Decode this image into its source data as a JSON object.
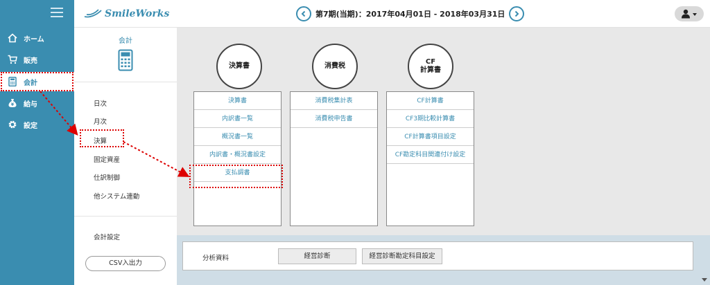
{
  "header": {
    "logo_text": "SmileWorks",
    "period": "第7期(当期)：2017年04月01日 - 2018年03月31日"
  },
  "nav": {
    "items": [
      {
        "label": "ホーム",
        "icon": "home-icon"
      },
      {
        "label": "販売",
        "icon": "cart-icon"
      },
      {
        "label": "会計",
        "icon": "calculator-icon",
        "active": true
      },
      {
        "label": "給与",
        "icon": "money-bag-icon"
      },
      {
        "label": "設定",
        "icon": "gear-icon"
      }
    ]
  },
  "submenu": {
    "title": "会計",
    "items": [
      "日次",
      "月次",
      "決算",
      "固定資産",
      "仕訳制御",
      "他システム連動"
    ],
    "settings": "会計設定",
    "csv_button": "CSV入出力"
  },
  "categories": [
    {
      "title": "決算書",
      "links": [
        "決算書",
        "内訳書一覧",
        "概況書一覧",
        "内訳書・概況書設定",
        "支払調書"
      ]
    },
    {
      "title": "消費税",
      "links": [
        "消費税集計表",
        "消費税申告書"
      ]
    },
    {
      "title_line1": "CF",
      "title_line2": "計算書",
      "links": [
        "CF計算書",
        "CF3期比較計算書",
        "CF計算書項目設定",
        "CF勘定科目関連付け設定"
      ]
    }
  ],
  "analysis": {
    "label": "分析資料",
    "buttons": [
      "経営診断",
      "経営診断勘定科目設定"
    ]
  },
  "colors": {
    "accent": "#3a8db0",
    "highlight": "#dd0000"
  }
}
